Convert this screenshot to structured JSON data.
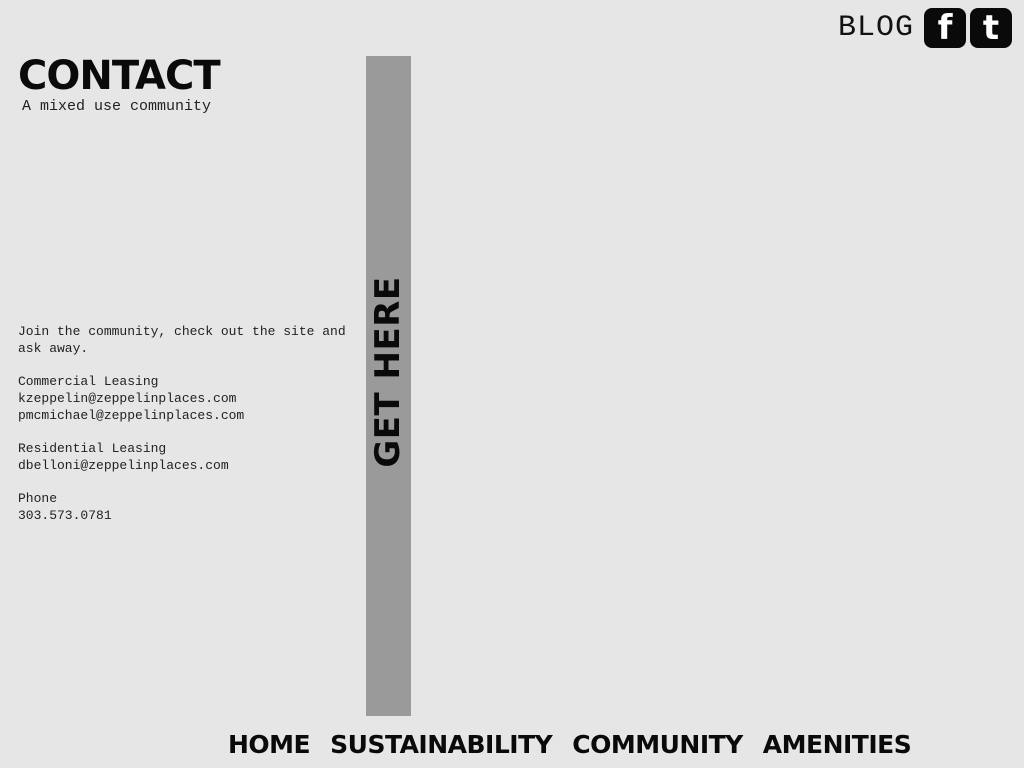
{
  "header": {
    "title": "CONTACT",
    "subtitle": "A mixed use community"
  },
  "top_links": {
    "blog": "BLOG",
    "facebook_icon": "f",
    "twitter_icon": "t"
  },
  "contact": {
    "intro": "Join the community, check out the site and ask away.",
    "commercial": {
      "label": "Commercial Leasing",
      "emails": [
        "kzeppelin@zeppelinplaces.com",
        "pmcmichael@zeppelinplaces.com"
      ]
    },
    "residential": {
      "label": "Residential Leasing",
      "emails": [
        "dbelloni@zeppelinplaces.com"
      ]
    },
    "phone": {
      "label": "Phone",
      "number": "303.573.0781"
    }
  },
  "sidebar": {
    "get_here": "GET HERE"
  },
  "nav": {
    "items": [
      "HOME",
      "SUSTAINABILITY",
      "COMMUNITY",
      "AMENITIES"
    ]
  },
  "colors": {
    "background": "#e6e6e6",
    "bar": "#9a9a9a",
    "text": "#0a0a0a"
  }
}
